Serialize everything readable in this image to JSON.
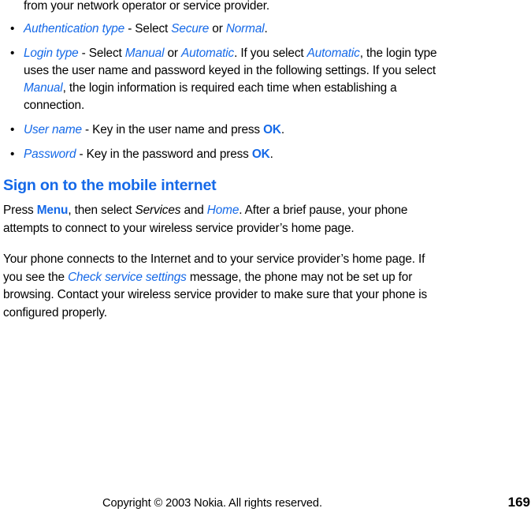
{
  "page": {
    "background": "#ffffff",
    "accent_color": "#1569e8",
    "text_color": "#000000"
  },
  "continuation": {
    "text": "from your network operator or service provider."
  },
  "bullets": [
    {
      "marker": "•",
      "runs": [
        {
          "text": "Authentication type",
          "style": "blue-italic"
        },
        {
          "text": " - Select ",
          "style": "plain"
        },
        {
          "text": "Secure",
          "style": "blue-italic"
        },
        {
          "text": " or ",
          "style": "plain"
        },
        {
          "text": "Normal",
          "style": "blue-italic"
        },
        {
          "text": ".",
          "style": "plain"
        }
      ]
    },
    {
      "marker": "•",
      "runs": [
        {
          "text": "Login type",
          "style": "blue-italic"
        },
        {
          "text": " - Select ",
          "style": "plain"
        },
        {
          "text": "Manual",
          "style": "blue-italic"
        },
        {
          "text": " or ",
          "style": "plain"
        },
        {
          "text": "Automatic",
          "style": "blue-italic"
        },
        {
          "text": ". If you select ",
          "style": "plain"
        },
        {
          "text": "Automatic",
          "style": "blue-italic"
        },
        {
          "text": ", the login type uses the user name and password keyed in the following settings. If you select ",
          "style": "plain"
        },
        {
          "text": "Manual",
          "style": "blue-italic"
        },
        {
          "text": ", the login information is required each time when establishing a connection.",
          "style": "plain"
        }
      ]
    },
    {
      "marker": "•",
      "runs": [
        {
          "text": "User name",
          "style": "blue-italic"
        },
        {
          "text": " - Key in the user name and press ",
          "style": "plain"
        },
        {
          "text": "OK",
          "style": "blue-bold"
        },
        {
          "text": ".",
          "style": "plain"
        }
      ]
    },
    {
      "marker": "•",
      "runs": [
        {
          "text": "Password",
          "style": "blue-italic"
        },
        {
          "text": " - Key in the password and press ",
          "style": "plain"
        },
        {
          "text": "OK",
          "style": "blue-bold"
        },
        {
          "text": ".",
          "style": "plain"
        }
      ]
    }
  ],
  "heading": {
    "text": "Sign on to the mobile internet"
  },
  "paragraphs": [
    {
      "runs": [
        {
          "text": "Press ",
          "style": "plain"
        },
        {
          "text": "Menu",
          "style": "blue-bold"
        },
        {
          "text": ", then select ",
          "style": "plain"
        },
        {
          "text": "Services",
          "style": "black-italic"
        },
        {
          "text": " and ",
          "style": "plain"
        },
        {
          "text": "Home",
          "style": "blue-italic"
        },
        {
          "text": ". After a brief pause, your phone attempts to connect to your wireless service provider’s home page.",
          "style": "plain"
        }
      ]
    },
    {
      "runs": [
        {
          "text": "Your phone connects to the Internet and to your service provider’s home page. If you see the ",
          "style": "plain"
        },
        {
          "text": "Check service settings",
          "style": "blue-italic"
        },
        {
          "text": " message, the phone may not be set up for browsing. Contact your wireless service provider to make sure that your phone is configured properly.",
          "style": "plain"
        }
      ]
    }
  ],
  "footer": {
    "copyright": "Copyright © 2003 Nokia. All rights reserved.",
    "page_number": "169"
  }
}
